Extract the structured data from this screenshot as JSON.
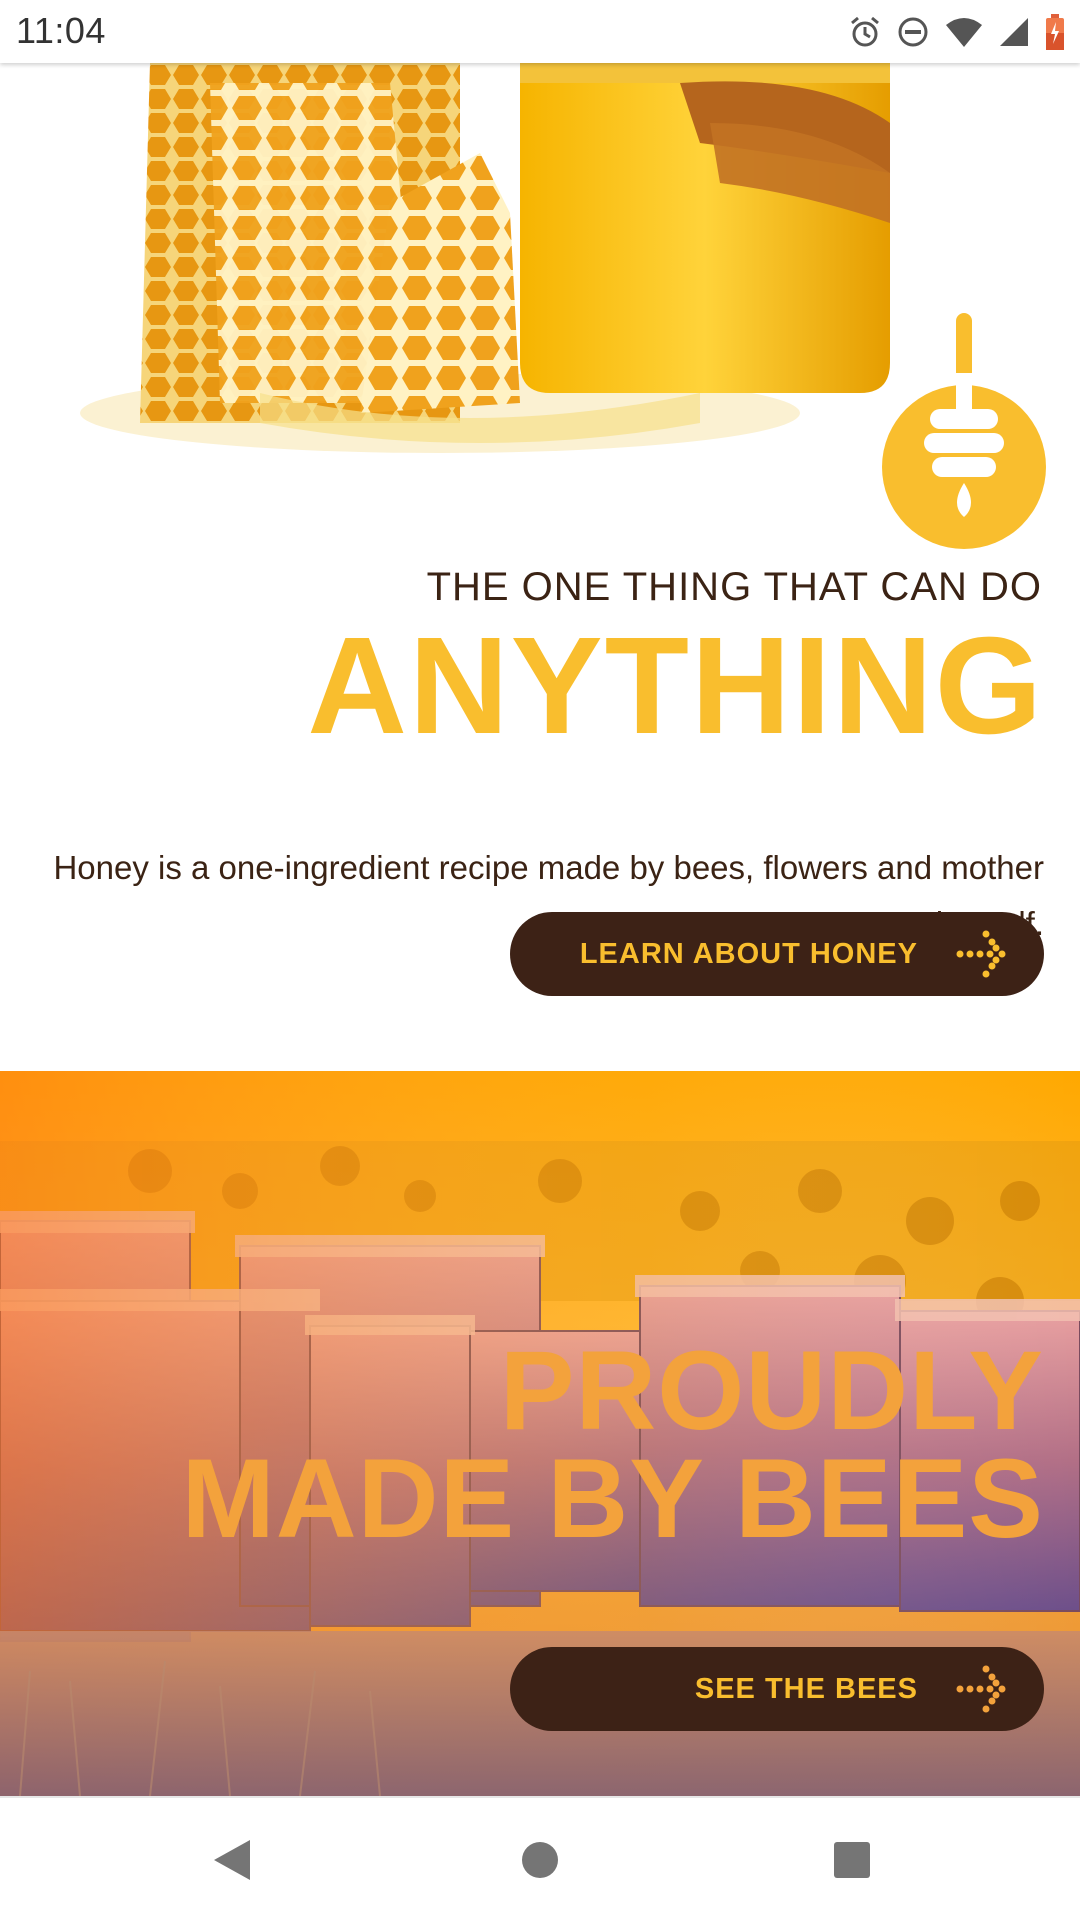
{
  "status_bar": {
    "time": "11:04",
    "icons": [
      "alarm-icon",
      "do-not-disturb-icon",
      "wifi-icon",
      "cell-signal-icon",
      "battery-icon"
    ]
  },
  "hero": {
    "eyebrow": "THE ONE THING THAT CAN DO",
    "headline": "ANYTHING",
    "description": "Honey is a one-ingredient recipe made by bees, flowers and mother nature herself.",
    "cta_label": "LEARN ABOUT HONEY",
    "badge_icon": "honey-dipper-icon"
  },
  "bees_section": {
    "title_line1": "PROUDLY",
    "title_line2": "MADE BY BEES",
    "cta_label": "SEE THE BEES"
  },
  "nav_bar": {
    "icons": [
      "back-icon",
      "home-icon",
      "recents-icon"
    ]
  },
  "colors": {
    "honey_yellow": "#f9be2e",
    "dark_brown": "#3d2216",
    "orange_title": "#f3a23c"
  }
}
